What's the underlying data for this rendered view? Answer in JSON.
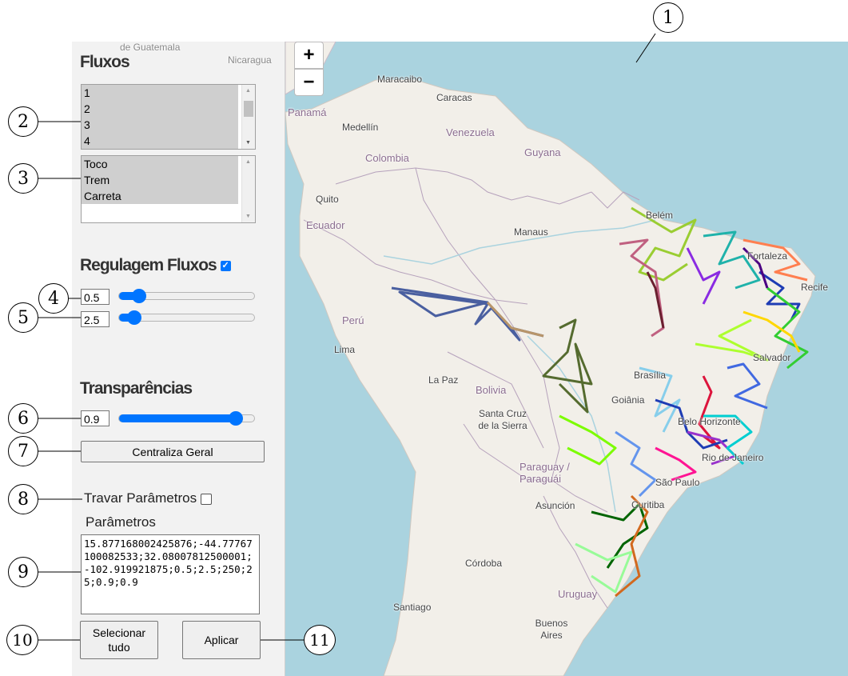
{
  "sidebar": {
    "fluxos_title": "Fluxos",
    "fluxos_options": [
      "1",
      "2",
      "3",
      "4"
    ],
    "vehicle_options": [
      "Toco",
      "Trem",
      "Carreta"
    ],
    "regulagem_title": "Regulagem Fluxos",
    "regulagem_enabled": true,
    "slider1": {
      "value": "0.5",
      "level": 0.12
    },
    "slider2": {
      "value": "2.5",
      "level": 0.09
    },
    "transparencias_title": "Transparências",
    "slider3": {
      "value": "0.9",
      "level": 0.88
    },
    "centraliza_label": "Centraliza Geral",
    "travar_label": "Travar Parâmetros",
    "travar_checked": false,
    "parametros_label": "Parâmetros",
    "parametros_value": "15.877168002425876;-44.77767100082533;32.08007812500001;-102.919921875;0.5;2.5;250;25;0.9;0.9",
    "selecionar_label": "Selecionar tudo",
    "aplicar_label": "Aplicar"
  },
  "map": {
    "zoom_in": "+",
    "zoom_out": "−",
    "labels": {
      "guatemala": "de Guatemala",
      "nicaragua": "Nicaragua",
      "panama": "Panamá",
      "maracaibo": "Maracaibo",
      "caracas": "Caracas",
      "medellin": "Medellín",
      "venezuela": "Venezuela",
      "colombia": "Colombia",
      "guyana": "Guyana",
      "quito": "Quito",
      "ecuador": "Ecuador",
      "belem": "Belém",
      "manaus": "Manaus",
      "fortaleza": "Fortaleza",
      "recife": "Recife",
      "peru": "Perú",
      "lima": "Lima",
      "salvador": "Salvador",
      "brasilia": "Brasília",
      "goiania": "Goiânia",
      "lapaz": "La Paz",
      "bolivia": "Bolivia",
      "santacruz": "Santa Cruz de la Sierra",
      "belohorizonte": "Belo Horizonte",
      "riodejaneiro": "Rio de Janeiro",
      "saopaulo": "São Paulo",
      "paraguay": "Paraguay / Paraguái",
      "asuncion": "Asunción",
      "curitiba": "Curitiba",
      "cordoba": "Córdoba",
      "uruguay": "Uruguay",
      "santiago": "Santiago",
      "buenosaires": "Buenos Aires"
    },
    "colors": {
      "sea": "#aad3df",
      "land": "#f2efe9",
      "border": "#9e8aa8",
      "rivers": "#aad3df"
    }
  },
  "callouts": [
    "1",
    "2",
    "3",
    "4",
    "5",
    "6",
    "7",
    "8",
    "9",
    "10",
    "11"
  ]
}
